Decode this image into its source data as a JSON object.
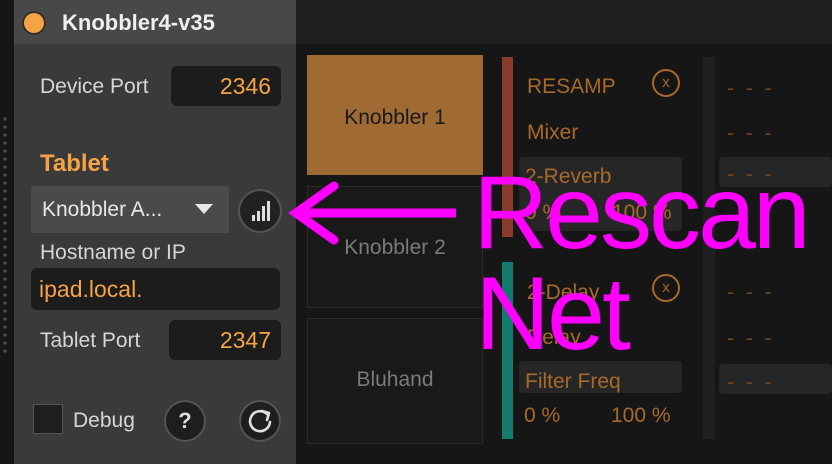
{
  "device": {
    "title": "Knobbler4-v35",
    "device_port_label": "Device Port",
    "device_port_value": "2346",
    "tablet_header": "Tablet",
    "tablet_select_value": "Knobbler A...",
    "hostname_label": "Hostname or IP",
    "hostname_value": "ipad.local.",
    "tablet_port_label": "Tablet Port",
    "tablet_port_value": "2347",
    "debug_label": "Debug",
    "help_label": "?"
  },
  "knobblers": [
    {
      "label": "Knobbler 1",
      "active": true
    },
    {
      "label": "Knobbler 2",
      "active": false
    },
    {
      "label": "Bluhand",
      "active": false
    }
  ],
  "params": [
    {
      "name": "RESAMP",
      "has_close": true,
      "close": "x"
    },
    {
      "name": "Mixer"
    },
    {
      "name": "2-Reverb",
      "min": "0 %",
      "max": "100 %"
    },
    {
      "name": "2-Delay",
      "has_close": true,
      "close": "x"
    },
    {
      "name": "Delay"
    },
    {
      "name": "Filter Freq",
      "min": "0 %",
      "max": "100 %"
    }
  ],
  "right_dashes": [
    "- - -",
    "- - -",
    "- - -",
    "- - -",
    "- - -",
    "- - -"
  ],
  "annotation": {
    "arrow_text": "Rescan",
    "second_line": "Net"
  },
  "colors": {
    "accent": "#f5a445",
    "magenta": "#ff00ff",
    "active_tile": "#a06a35",
    "red_bar": "#8a3b2e",
    "teal_bar": "#137a6e"
  }
}
